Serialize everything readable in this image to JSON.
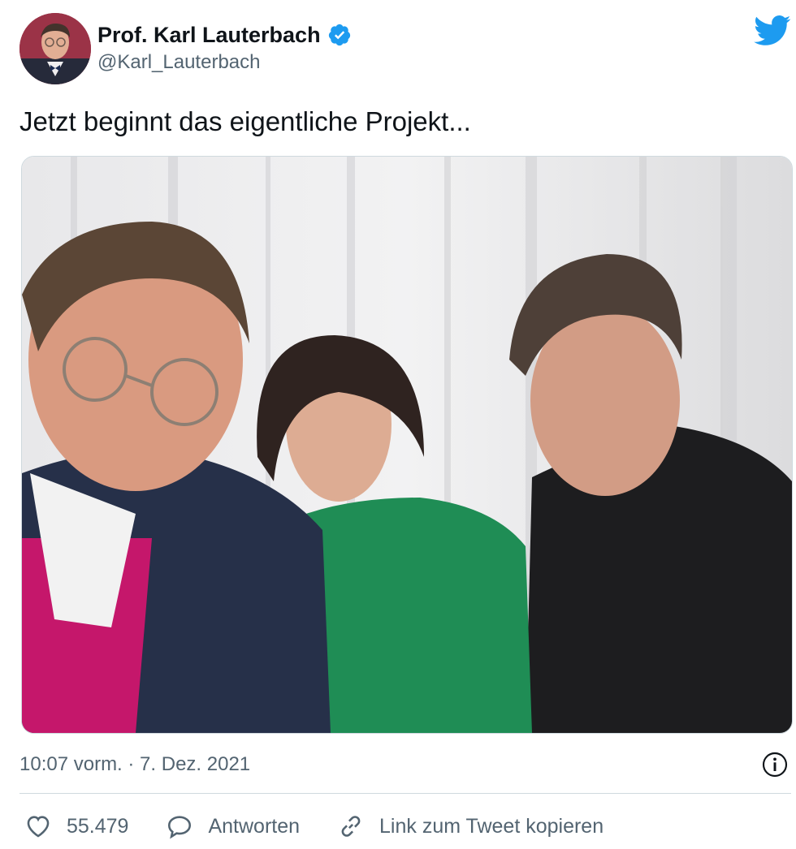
{
  "author": {
    "display_name": "Prof. Karl Lauterbach",
    "handle": "@Karl_Lauterbach",
    "verified": true,
    "avatar_icon": "profile-photo"
  },
  "tweet": {
    "text": "Jetzt beginnt das eigentliche Projekt...",
    "media_icon": "group-selfie-photo"
  },
  "meta": {
    "timestamp": "10:07 vorm. · 7. Dez. 2021",
    "info_icon": "info-icon"
  },
  "actions": {
    "like_count": "55.479",
    "reply_label": "Antworten",
    "copy_link_label": "Link zum Tweet kopieren"
  },
  "colors": {
    "brand_blue": "#1d9bf0",
    "text_primary": "#0f1419",
    "text_secondary": "#536471",
    "divider": "#cfd9de"
  }
}
